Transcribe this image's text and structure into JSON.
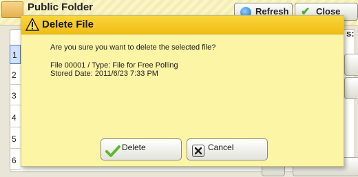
{
  "background": {
    "title": "Public Folder",
    "refresh_label": "Refresh",
    "close_label": "Close",
    "colon": "s:",
    "rows": [
      "1",
      "2",
      "3",
      "4",
      "5",
      "6"
    ]
  },
  "dialog": {
    "title": "Delete File",
    "message": "Are you sure you want to delete the selected file?",
    "file_line": "File 00001 / Type: File for Free Polling",
    "stored_line": "Stored Date: 2011/6/23 7:33 PM",
    "delete_label": "Delete",
    "cancel_label": "Cancel"
  },
  "colors": {
    "dialog_bg": "#fdf5a6",
    "dialog_header": "#f0bd14",
    "selected_row": "#cfe2ff"
  }
}
